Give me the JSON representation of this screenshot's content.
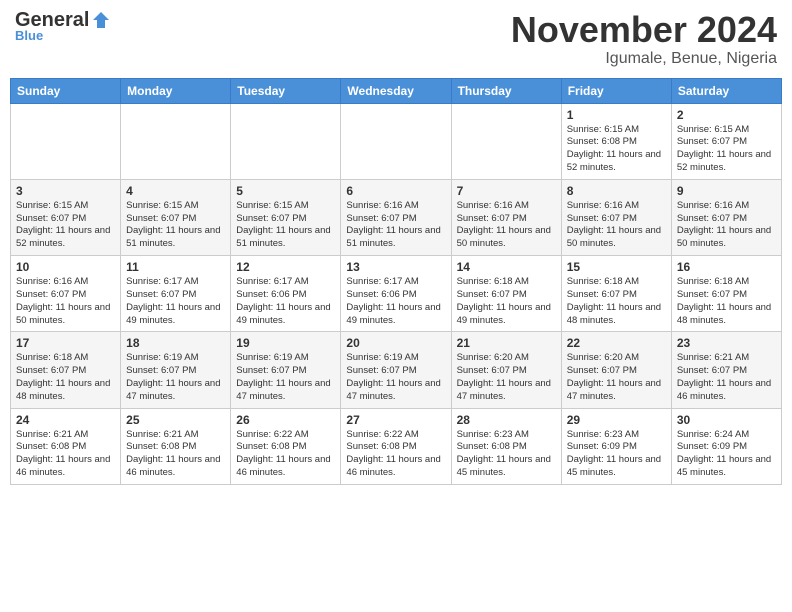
{
  "header": {
    "logo_general": "General",
    "logo_blue": "Blue",
    "month": "November 2024",
    "location": "Igumale, Benue, Nigeria"
  },
  "days_of_week": [
    "Sunday",
    "Monday",
    "Tuesday",
    "Wednesday",
    "Thursday",
    "Friday",
    "Saturday"
  ],
  "weeks": [
    [
      {
        "day": "",
        "info": ""
      },
      {
        "day": "",
        "info": ""
      },
      {
        "day": "",
        "info": ""
      },
      {
        "day": "",
        "info": ""
      },
      {
        "day": "",
        "info": ""
      },
      {
        "day": "1",
        "info": "Sunrise: 6:15 AM\nSunset: 6:08 PM\nDaylight: 11 hours and 52 minutes."
      },
      {
        "day": "2",
        "info": "Sunrise: 6:15 AM\nSunset: 6:07 PM\nDaylight: 11 hours and 52 minutes."
      }
    ],
    [
      {
        "day": "3",
        "info": "Sunrise: 6:15 AM\nSunset: 6:07 PM\nDaylight: 11 hours and 52 minutes."
      },
      {
        "day": "4",
        "info": "Sunrise: 6:15 AM\nSunset: 6:07 PM\nDaylight: 11 hours and 51 minutes."
      },
      {
        "day": "5",
        "info": "Sunrise: 6:15 AM\nSunset: 6:07 PM\nDaylight: 11 hours and 51 minutes."
      },
      {
        "day": "6",
        "info": "Sunrise: 6:16 AM\nSunset: 6:07 PM\nDaylight: 11 hours and 51 minutes."
      },
      {
        "day": "7",
        "info": "Sunrise: 6:16 AM\nSunset: 6:07 PM\nDaylight: 11 hours and 50 minutes."
      },
      {
        "day": "8",
        "info": "Sunrise: 6:16 AM\nSunset: 6:07 PM\nDaylight: 11 hours and 50 minutes."
      },
      {
        "day": "9",
        "info": "Sunrise: 6:16 AM\nSunset: 6:07 PM\nDaylight: 11 hours and 50 minutes."
      }
    ],
    [
      {
        "day": "10",
        "info": "Sunrise: 6:16 AM\nSunset: 6:07 PM\nDaylight: 11 hours and 50 minutes."
      },
      {
        "day": "11",
        "info": "Sunrise: 6:17 AM\nSunset: 6:07 PM\nDaylight: 11 hours and 49 minutes."
      },
      {
        "day": "12",
        "info": "Sunrise: 6:17 AM\nSunset: 6:06 PM\nDaylight: 11 hours and 49 minutes."
      },
      {
        "day": "13",
        "info": "Sunrise: 6:17 AM\nSunset: 6:06 PM\nDaylight: 11 hours and 49 minutes."
      },
      {
        "day": "14",
        "info": "Sunrise: 6:18 AM\nSunset: 6:07 PM\nDaylight: 11 hours and 49 minutes."
      },
      {
        "day": "15",
        "info": "Sunrise: 6:18 AM\nSunset: 6:07 PM\nDaylight: 11 hours and 48 minutes."
      },
      {
        "day": "16",
        "info": "Sunrise: 6:18 AM\nSunset: 6:07 PM\nDaylight: 11 hours and 48 minutes."
      }
    ],
    [
      {
        "day": "17",
        "info": "Sunrise: 6:18 AM\nSunset: 6:07 PM\nDaylight: 11 hours and 48 minutes."
      },
      {
        "day": "18",
        "info": "Sunrise: 6:19 AM\nSunset: 6:07 PM\nDaylight: 11 hours and 47 minutes."
      },
      {
        "day": "19",
        "info": "Sunrise: 6:19 AM\nSunset: 6:07 PM\nDaylight: 11 hours and 47 minutes."
      },
      {
        "day": "20",
        "info": "Sunrise: 6:19 AM\nSunset: 6:07 PM\nDaylight: 11 hours and 47 minutes."
      },
      {
        "day": "21",
        "info": "Sunrise: 6:20 AM\nSunset: 6:07 PM\nDaylight: 11 hours and 47 minutes."
      },
      {
        "day": "22",
        "info": "Sunrise: 6:20 AM\nSunset: 6:07 PM\nDaylight: 11 hours and 47 minutes."
      },
      {
        "day": "23",
        "info": "Sunrise: 6:21 AM\nSunset: 6:07 PM\nDaylight: 11 hours and 46 minutes."
      }
    ],
    [
      {
        "day": "24",
        "info": "Sunrise: 6:21 AM\nSunset: 6:08 PM\nDaylight: 11 hours and 46 minutes."
      },
      {
        "day": "25",
        "info": "Sunrise: 6:21 AM\nSunset: 6:08 PM\nDaylight: 11 hours and 46 minutes."
      },
      {
        "day": "26",
        "info": "Sunrise: 6:22 AM\nSunset: 6:08 PM\nDaylight: 11 hours and 46 minutes."
      },
      {
        "day": "27",
        "info": "Sunrise: 6:22 AM\nSunset: 6:08 PM\nDaylight: 11 hours and 46 minutes."
      },
      {
        "day": "28",
        "info": "Sunrise: 6:23 AM\nSunset: 6:08 PM\nDaylight: 11 hours and 45 minutes."
      },
      {
        "day": "29",
        "info": "Sunrise: 6:23 AM\nSunset: 6:09 PM\nDaylight: 11 hours and 45 minutes."
      },
      {
        "day": "30",
        "info": "Sunrise: 6:24 AM\nSunset: 6:09 PM\nDaylight: 11 hours and 45 minutes."
      }
    ]
  ]
}
